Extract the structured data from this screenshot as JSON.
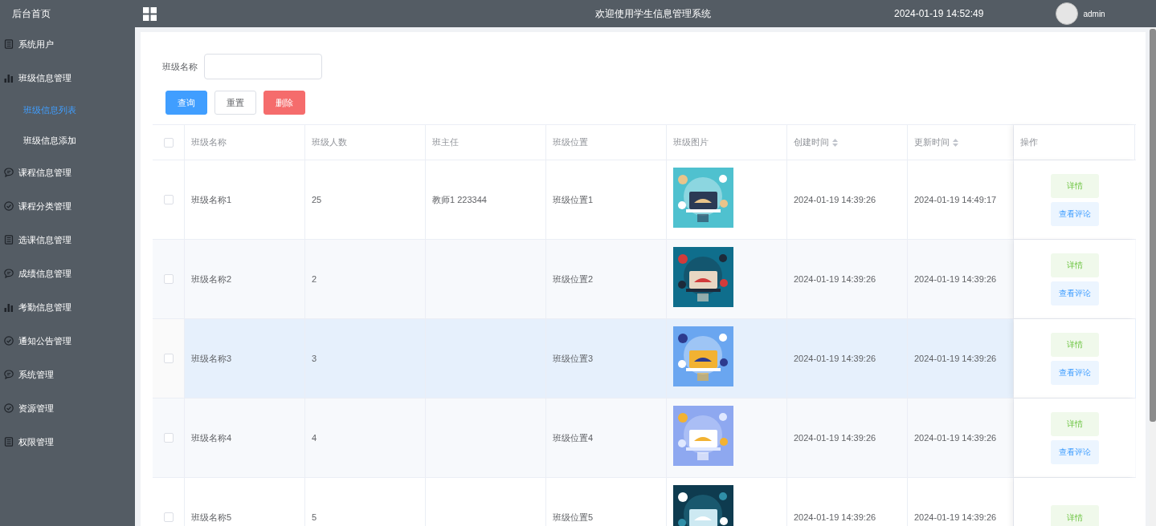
{
  "sidebar": {
    "home": "后台首页",
    "items": [
      {
        "label": "系统用户",
        "kind": "doc"
      },
      {
        "label": "班级信息管理",
        "kind": "bars",
        "children": [
          {
            "label": "班级信息列表",
            "selected": true
          },
          {
            "label": "班级信息添加",
            "selected": false
          }
        ]
      },
      {
        "label": "课程信息管理",
        "kind": "chat"
      },
      {
        "label": "课程分类管理",
        "kind": "check"
      },
      {
        "label": "选课信息管理",
        "kind": "doc"
      },
      {
        "label": "成绩信息管理",
        "kind": "chat"
      },
      {
        "label": "考勤信息管理",
        "kind": "bars"
      },
      {
        "label": "通知公告管理",
        "kind": "check"
      },
      {
        "label": "系统管理",
        "kind": "chat"
      },
      {
        "label": "资源管理",
        "kind": "check"
      },
      {
        "label": "权限管理",
        "kind": "doc"
      }
    ]
  },
  "header": {
    "title": "欢迎使用学生信息管理系统",
    "datetime": "2024-01-19 14:52:49",
    "user": "admin"
  },
  "search": {
    "label": "班级名称",
    "buttons": [
      {
        "label": "查询",
        "kind": "primary"
      },
      {
        "label": "重置",
        "kind": "plain"
      },
      {
        "label": "删除",
        "kind": "danger"
      }
    ]
  },
  "table": {
    "header_checked": false,
    "columns": [
      {
        "label": "班级名称",
        "sortable": false
      },
      {
        "label": "班级人数",
        "sortable": false
      },
      {
        "label": "班主任",
        "sortable": false
      },
      {
        "label": "班级位置",
        "sortable": false
      },
      {
        "label": "班级图片",
        "sortable": false
      },
      {
        "label": "创建时间",
        "sortable": true
      },
      {
        "label": "更新时间",
        "sortable": true
      },
      {
        "label": "操作",
        "sortable": false
      }
    ],
    "rows": [
      {
        "checked": false,
        "hovered": false,
        "cells": [
          "班级名称1",
          "25",
          "教师1 223344",
          "班级位置1",
          "",
          "2024-01-19 14:39:26",
          "2024-01-19 14:49:17"
        ],
        "actions": [
          "详情",
          "查看评论"
        ]
      },
      {
        "checked": false,
        "hovered": false,
        "cells": [
          "班级名称2",
          "2",
          "",
          "班级位置2",
          "",
          "2024-01-19 14:39:26",
          "2024-01-19 14:39:26"
        ],
        "actions": [
          "详情",
          "查看评论"
        ]
      },
      {
        "checked": false,
        "hovered": true,
        "cells": [
          "班级名称3",
          "3",
          "",
          "班级位置3",
          "",
          "2024-01-19 14:39:26",
          "2024-01-19 14:39:26"
        ],
        "actions": [
          "详情",
          "查看评论"
        ]
      },
      {
        "checked": false,
        "hovered": false,
        "cells": [
          "班级名称4",
          "4",
          "",
          "班级位置4",
          "",
          "2024-01-19 14:39:26",
          "2024-01-19 14:39:26"
        ],
        "actions": [
          "详情",
          "查看评论"
        ]
      },
      {
        "checked": false,
        "hovered": false,
        "cells": [
          "班级名称5",
          "5",
          "",
          "班级位置5",
          "",
          "2024-01-19 14:39:26",
          "2024-01-19 14:39:26"
        ],
        "actions": [
          "详情"
        ]
      }
    ]
  }
}
